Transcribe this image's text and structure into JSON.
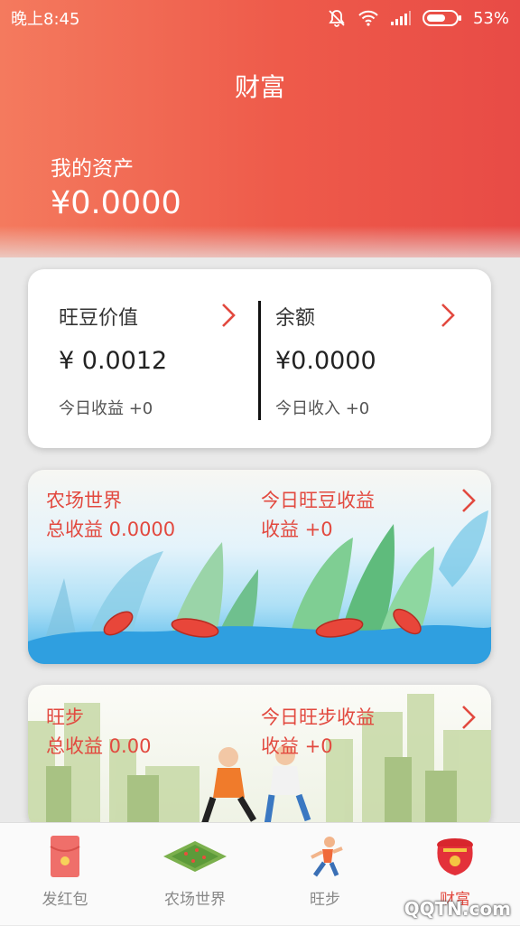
{
  "status": {
    "time": "晚上8:45",
    "battery": "53%"
  },
  "header": {
    "title": "财富",
    "asset_label": "我的资产",
    "asset_value": "¥0.0000"
  },
  "summary": {
    "left": {
      "name": "旺豆价值",
      "value": "¥ 0.0012",
      "sub": "今日收益 +0"
    },
    "right": {
      "name": "余额",
      "value": "¥0.0000",
      "sub": "今日收入 +0"
    }
  },
  "farm_banner": {
    "l1": "农场世界",
    "l2": "总收益 0.0000",
    "r1": "今日旺豆收益",
    "r2": "收益 +0"
  },
  "steps_banner": {
    "l1": "旺步",
    "l2": "总收益 0.00",
    "r1": "今日旺步收益",
    "r2": "收益 +0"
  },
  "tabs": [
    {
      "label": "发红包",
      "icon": "red-envelope-icon"
    },
    {
      "label": "农场世界",
      "icon": "farm-field-icon"
    },
    {
      "label": "旺步",
      "icon": "runner-icon"
    },
    {
      "label": "财富",
      "icon": "treasure-pot-icon",
      "active": true
    }
  ],
  "watermark": "QQTN.com",
  "colors": {
    "accent": "#e2493f",
    "header_start": "#f47a5e",
    "header_end": "#e84b46"
  }
}
